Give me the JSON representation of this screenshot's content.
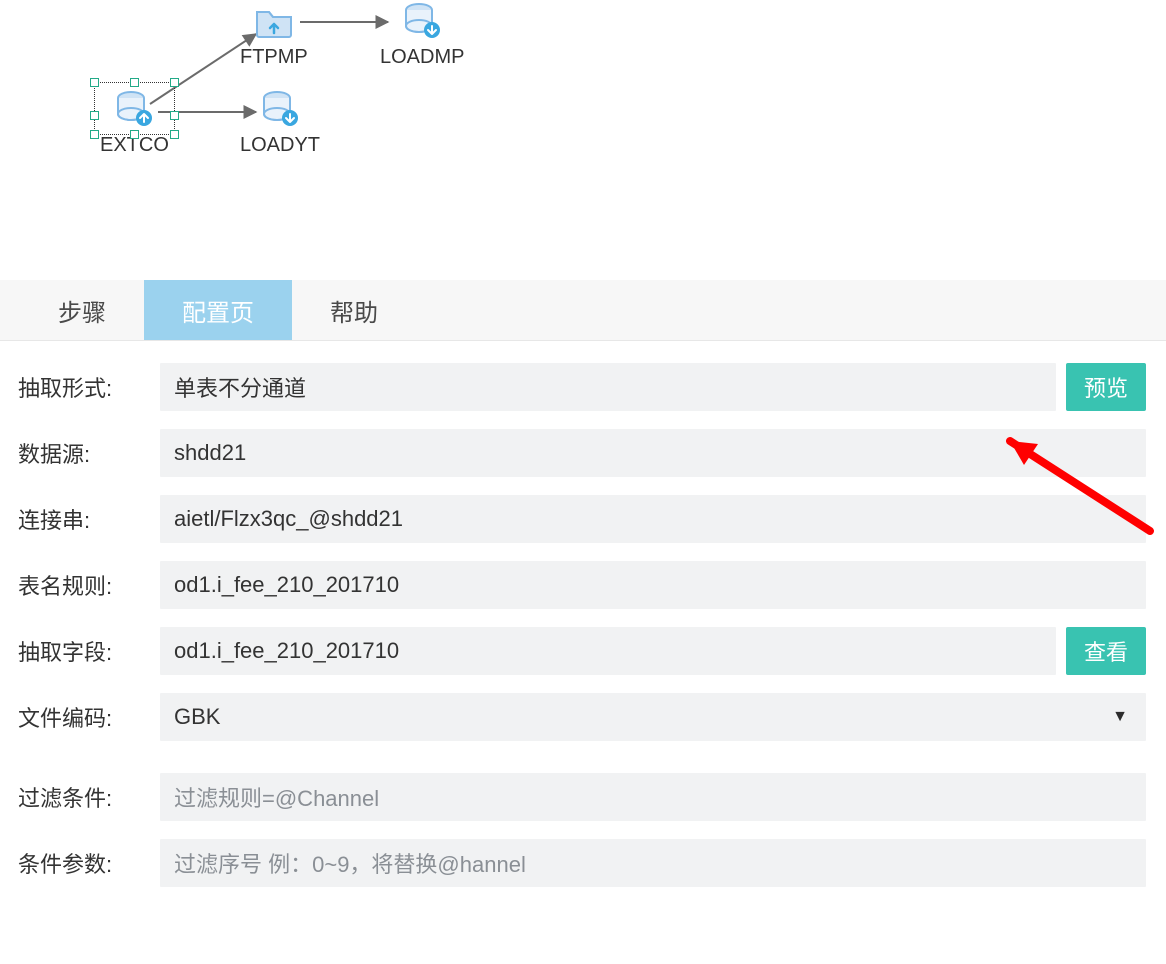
{
  "diagram": {
    "nodes": {
      "extco": {
        "label": "EXTCO",
        "type": "db-export",
        "selected": true
      },
      "ftpmp": {
        "label": "FTPMP",
        "type": "folder-upload"
      },
      "loadmp": {
        "label": "LOADMP",
        "type": "db-import"
      },
      "loadyt": {
        "label": "LOADYT",
        "type": "db-import"
      }
    },
    "edges": [
      [
        "extco",
        "ftpmp"
      ],
      [
        "ftpmp",
        "loadmp"
      ],
      [
        "extco",
        "loadyt"
      ]
    ]
  },
  "tabs": {
    "step": "步骤",
    "config": "配置页",
    "help": "帮助",
    "active": "config"
  },
  "form": {
    "extract_mode": {
      "label": "抽取形式:",
      "value": "单表不分通道"
    },
    "datasource": {
      "label": "数据源:",
      "value": "shdd21"
    },
    "connection": {
      "label": "连接串:",
      "value": "aietl/Flzx3qc_@shdd21"
    },
    "table_rule": {
      "label": "表名规则:",
      "value": "od1.i_fee_210_201710"
    },
    "fields": {
      "label": "抽取字段:",
      "value": "od1.i_fee_210_201710"
    },
    "encoding": {
      "label": "文件编码:",
      "value": "GBK"
    },
    "filter": {
      "label": "过滤条件:",
      "placeholder": "过滤规则=@Channel"
    },
    "params": {
      "label": "条件参数:",
      "placeholder": "过滤序号 例：0~9，将替换@hannel"
    }
  },
  "buttons": {
    "preview": "预览",
    "view": "查看"
  },
  "colors": {
    "tab_active_bg": "#9bd2ee",
    "btn_bg": "#39c3b1",
    "icon_blue": "#7fb7e6",
    "icon_badge": "#3aa7e0"
  }
}
